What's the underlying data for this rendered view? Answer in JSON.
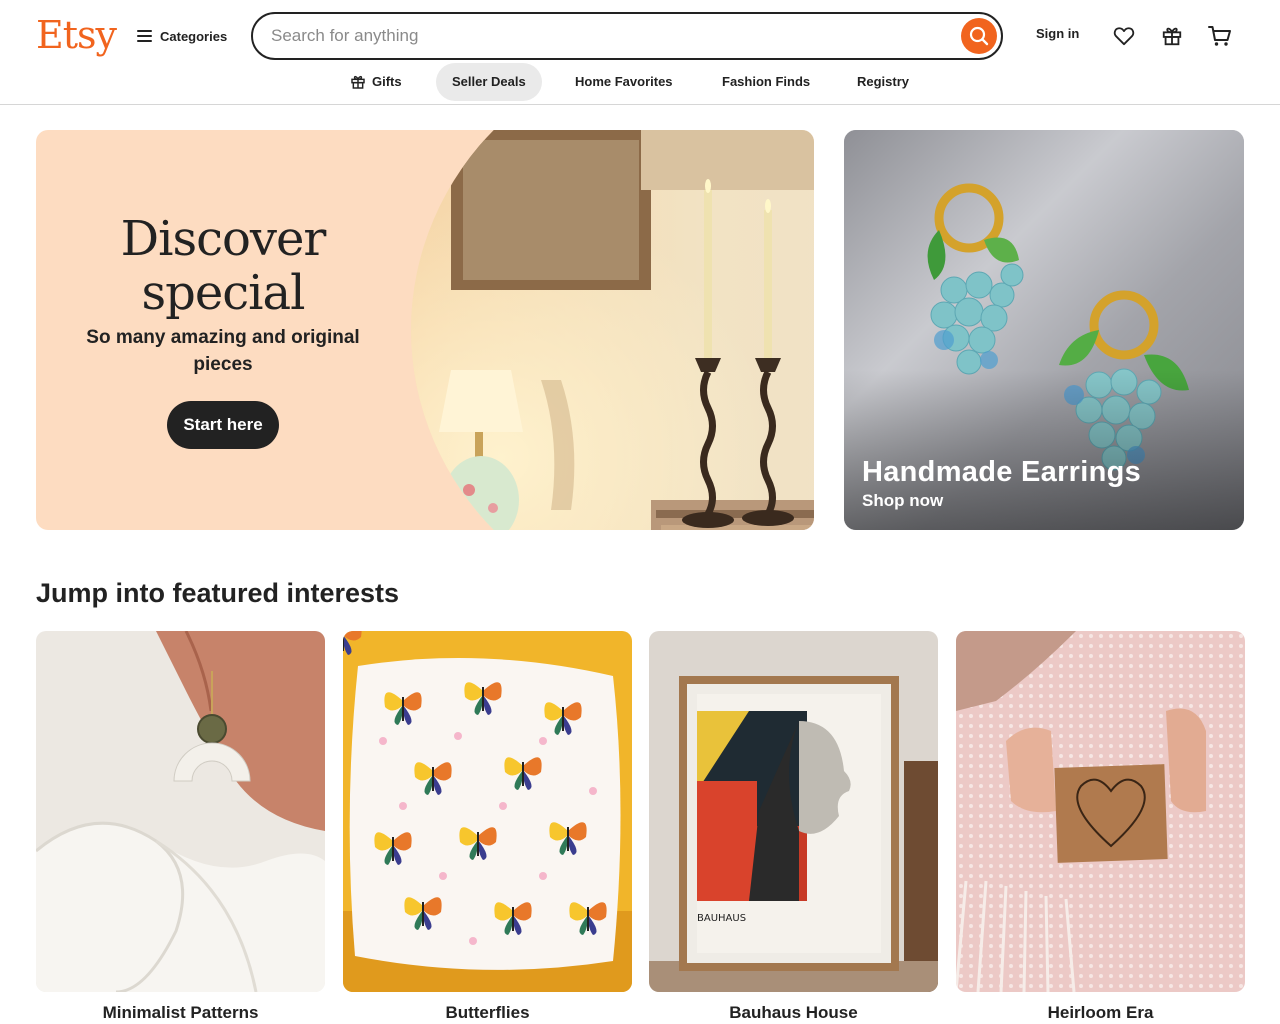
{
  "header": {
    "logo": "Etsy",
    "categories_label": "Categories",
    "search_placeholder": "Search for anything",
    "signin_label": "Sign in"
  },
  "subnav": {
    "items": [
      {
        "label": "Gifts",
        "icon": "gift-icon"
      },
      {
        "label": "Seller Deals",
        "active": true
      },
      {
        "label": "Home Favorites"
      },
      {
        "label": "Fashion Finds"
      },
      {
        "label": "Registry"
      }
    ]
  },
  "hero": {
    "title_line1": "Discover",
    "title_line2": "special",
    "subtitle": "So many amazing and original pieces",
    "button": "Start here"
  },
  "promo": {
    "title": "Handmade Earrings",
    "link": "Shop now"
  },
  "featured": {
    "title": "Jump into featured interests",
    "items": [
      {
        "label": "Minimalist Patterns"
      },
      {
        "label": "Butterflies"
      },
      {
        "label": "Bauhaus House"
      },
      {
        "label": "Heirloom Era"
      }
    ]
  },
  "colors": {
    "brand": "#f1641e",
    "hero_bg": "#fddcc1",
    "text": "#222222"
  }
}
